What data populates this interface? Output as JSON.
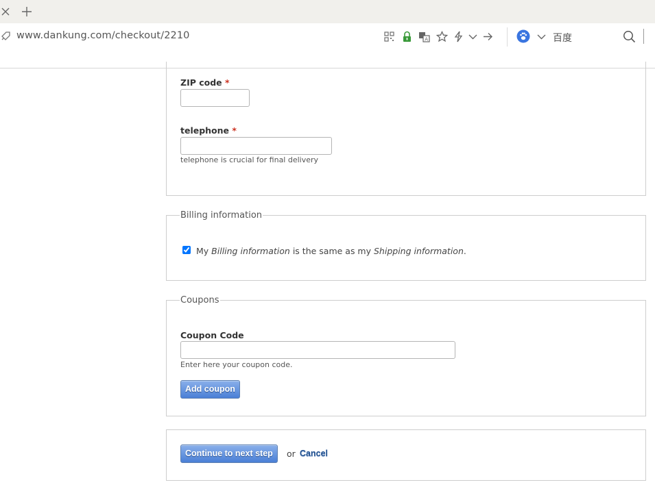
{
  "browser": {
    "url": "www.dankung.com/checkout/2210",
    "search_engine": "百度"
  },
  "address": {
    "zip_label": "ZIP code",
    "zip_value": "",
    "phone_label": "telephone",
    "phone_value": "",
    "phone_hint": "telephone is crucial for final delivery",
    "required_marker": "*"
  },
  "billing": {
    "legend": "Billing information",
    "same_as_shipping_checked": true,
    "text_prefix": "My",
    "text_billing": "Billing information",
    "text_middle": "is the same as my",
    "text_shipping": "Shipping information",
    "text_suffix": "."
  },
  "coupons": {
    "legend": "Coupons",
    "code_label": "Coupon Code",
    "code_value": "",
    "code_hint": "Enter here your coupon code.",
    "add_button": "Add coupon"
  },
  "actions": {
    "continue_button": "Continue to next step",
    "or_text": "or",
    "cancel_link": "Cancel"
  },
  "colors": {
    "button_top": "#8ab0ea",
    "button_bottom": "#4a7fd6",
    "required": "#cc3322",
    "link": "#1f4f8f"
  }
}
